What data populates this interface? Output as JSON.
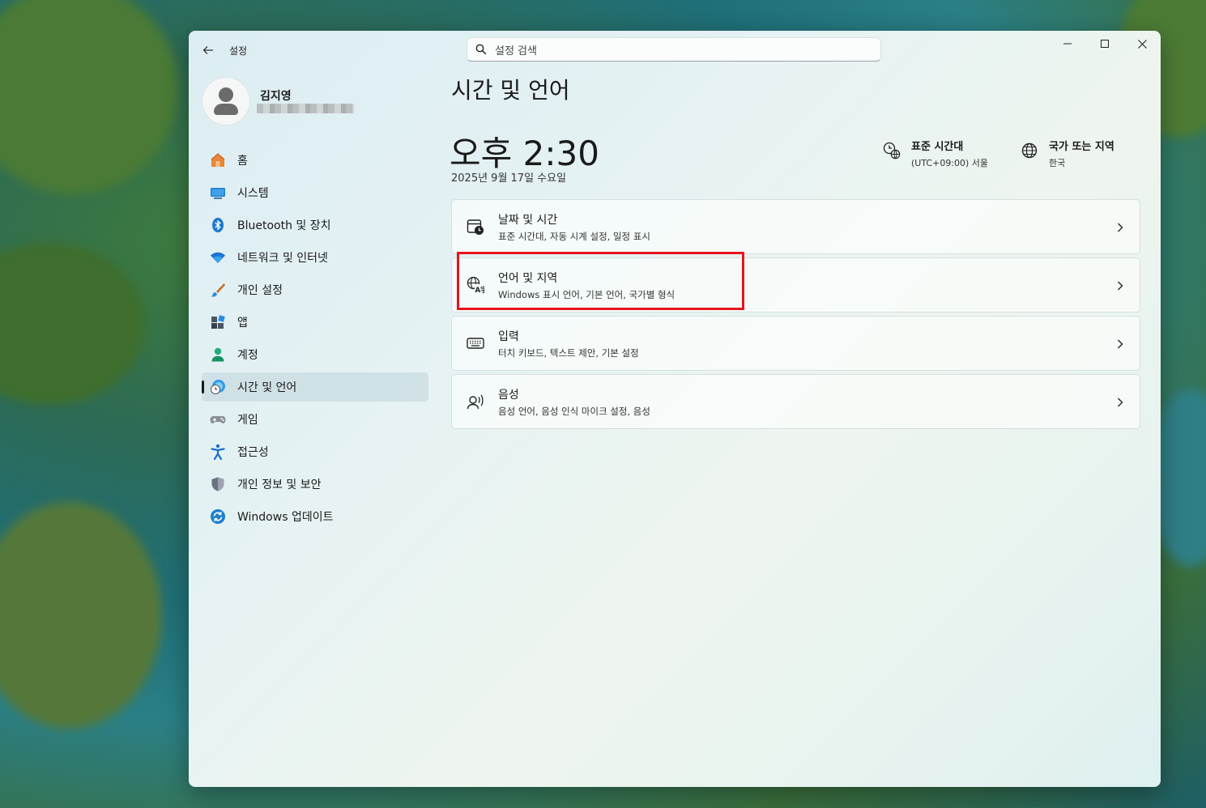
{
  "window": {
    "app_title": "설정",
    "search_placeholder": "설정 검색",
    "controls": {
      "minimize": "minimize-icon",
      "maximize": "maximize-icon",
      "close": "close-icon"
    }
  },
  "user": {
    "name": "김지영"
  },
  "sidebar": {
    "items": [
      {
        "label": "홈",
        "icon": "home-icon"
      },
      {
        "label": "시스템",
        "icon": "system-icon"
      },
      {
        "label": "Bluetooth 및 장치",
        "icon": "bluetooth-icon"
      },
      {
        "label": "네트워크 및 인터넷",
        "icon": "network-icon"
      },
      {
        "label": "개인 설정",
        "icon": "brush-icon"
      },
      {
        "label": "앱",
        "icon": "apps-icon"
      },
      {
        "label": "계정",
        "icon": "account-icon"
      },
      {
        "label": "시간 및 언어",
        "icon": "time-language-icon",
        "selected": true
      },
      {
        "label": "게임",
        "icon": "gamepad-icon"
      },
      {
        "label": "접근성",
        "icon": "accessibility-icon"
      },
      {
        "label": "개인 정보 및 보안",
        "icon": "shield-icon"
      },
      {
        "label": "Windows 업데이트",
        "icon": "update-icon"
      }
    ]
  },
  "main": {
    "page_title": "시간 및 언어",
    "clock": "오후 2:30",
    "date": "2025년 9월 17일 수요일",
    "timezone": {
      "title": "표준 시간대",
      "value": "(UTC+09:00) 서울"
    },
    "region": {
      "title": "국가 또는 지역",
      "value": "한국"
    },
    "cards": [
      {
        "title": "날짜 및 시간",
        "subtitle": "표준 시간대, 자동 시계 설정, 일정 표시",
        "icon": "calendar-clock-icon"
      },
      {
        "title": "언어 및 지역",
        "subtitle": "Windows 표시 언어, 기본 언어, 국가별 형식",
        "icon": "language-icon"
      },
      {
        "title": "입력",
        "subtitle": "터치 키보드, 텍스트 제안, 기본 설정",
        "icon": "keyboard-icon"
      },
      {
        "title": "음성",
        "subtitle": "음성 언어, 음성 인식 마이크 설정, 음성",
        "icon": "speech-icon"
      }
    ]
  },
  "colors": {
    "accent": "#0067c0",
    "highlight_box": "#e8141c"
  }
}
